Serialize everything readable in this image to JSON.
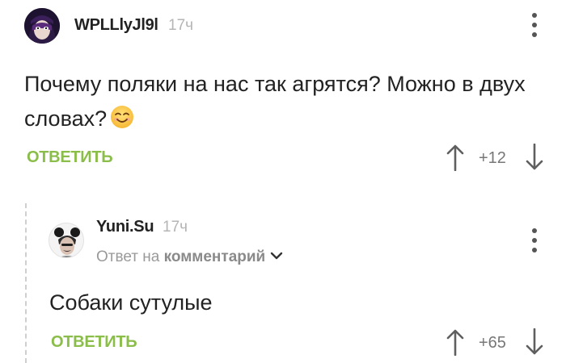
{
  "comments": [
    {
      "username": "WPLLlyJl9l",
      "timestamp": "17ч",
      "text": "Почему поляки на нас так агрятся? Можно в двух словах?",
      "emoji": "smiling-face-emoji",
      "reply_label": "ОТВЕТИТЬ",
      "rating": "+12"
    },
    {
      "username": "Yuni.Su",
      "timestamp": "17ч",
      "reply_to_prefix": "Ответ на",
      "reply_to_link": "комментарий",
      "text": "Собаки сутулые",
      "reply_label": "ОТВЕТИТЬ",
      "rating": "+65"
    }
  ],
  "icons": {
    "menu": "vertical-ellipsis-icon",
    "upvote": "arrow-up-icon",
    "downvote": "arrow-down-icon",
    "expand": "chevron-down-icon"
  },
  "colors": {
    "accent_green": "#8bbd4a",
    "text": "#222222",
    "muted": "#9a9a9a"
  }
}
